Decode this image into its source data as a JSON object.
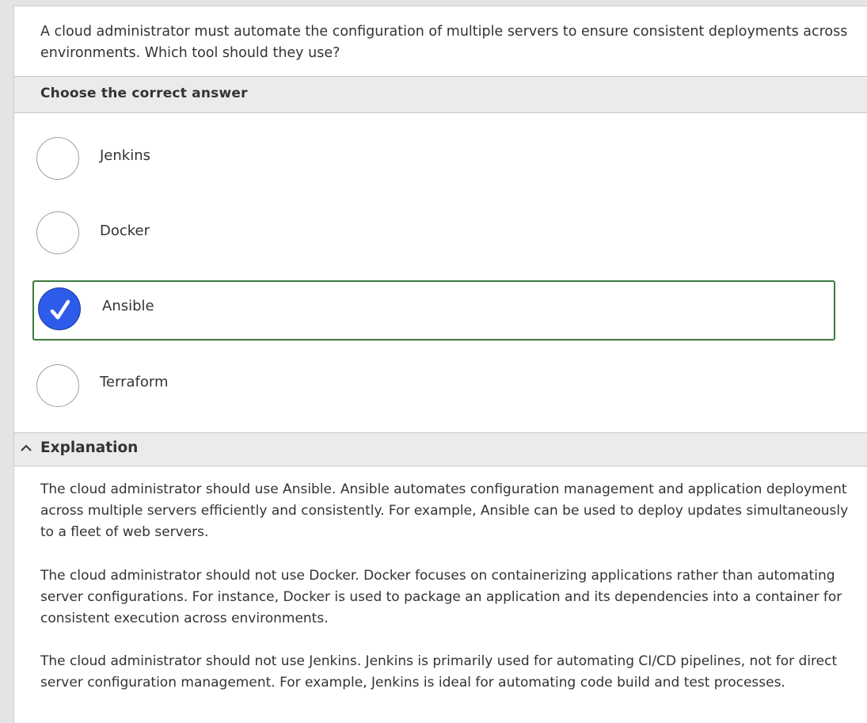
{
  "question": {
    "text": "A cloud administrator must automate the configuration of multiple servers to ensure consistent deployments across environments. Which tool should they use?"
  },
  "answers": {
    "heading": "Choose the correct answer",
    "options": [
      {
        "label": "Jenkins",
        "selected": false
      },
      {
        "label": "Docker",
        "selected": false
      },
      {
        "label": "Ansible",
        "selected": true
      },
      {
        "label": "Terraform",
        "selected": false
      }
    ]
  },
  "explanation": {
    "heading": "Explanation",
    "expanded": true,
    "paragraphs": [
      "The cloud administrator should use Ansible. Ansible automates configuration management and application deployment across multiple servers efficiently and consistently. For example, Ansible can be used to deploy updates simultaneously to a fleet of web servers.",
      "The cloud administrator should not use Docker. Docker focuses on containerizing applications rather than automating server configurations. For instance, Docker is used to package an application and its dependencies into a container for consistent execution across environments.",
      "The cloud administrator should not use Jenkins. Jenkins is primarily used for automating CI/CD pipelines, not for direct server configuration management. For example, Jenkins is ideal for automating code build and test processes."
    ]
  },
  "colors": {
    "page_background": "#e2e4e6",
    "bar_background": "#e9ebed",
    "selected_radio": "#2f5bea",
    "selected_border": "#3c7a3c",
    "text": "#333333"
  },
  "icons": {
    "checkmark": "check-icon",
    "collapse": "chevron-up-icon"
  }
}
